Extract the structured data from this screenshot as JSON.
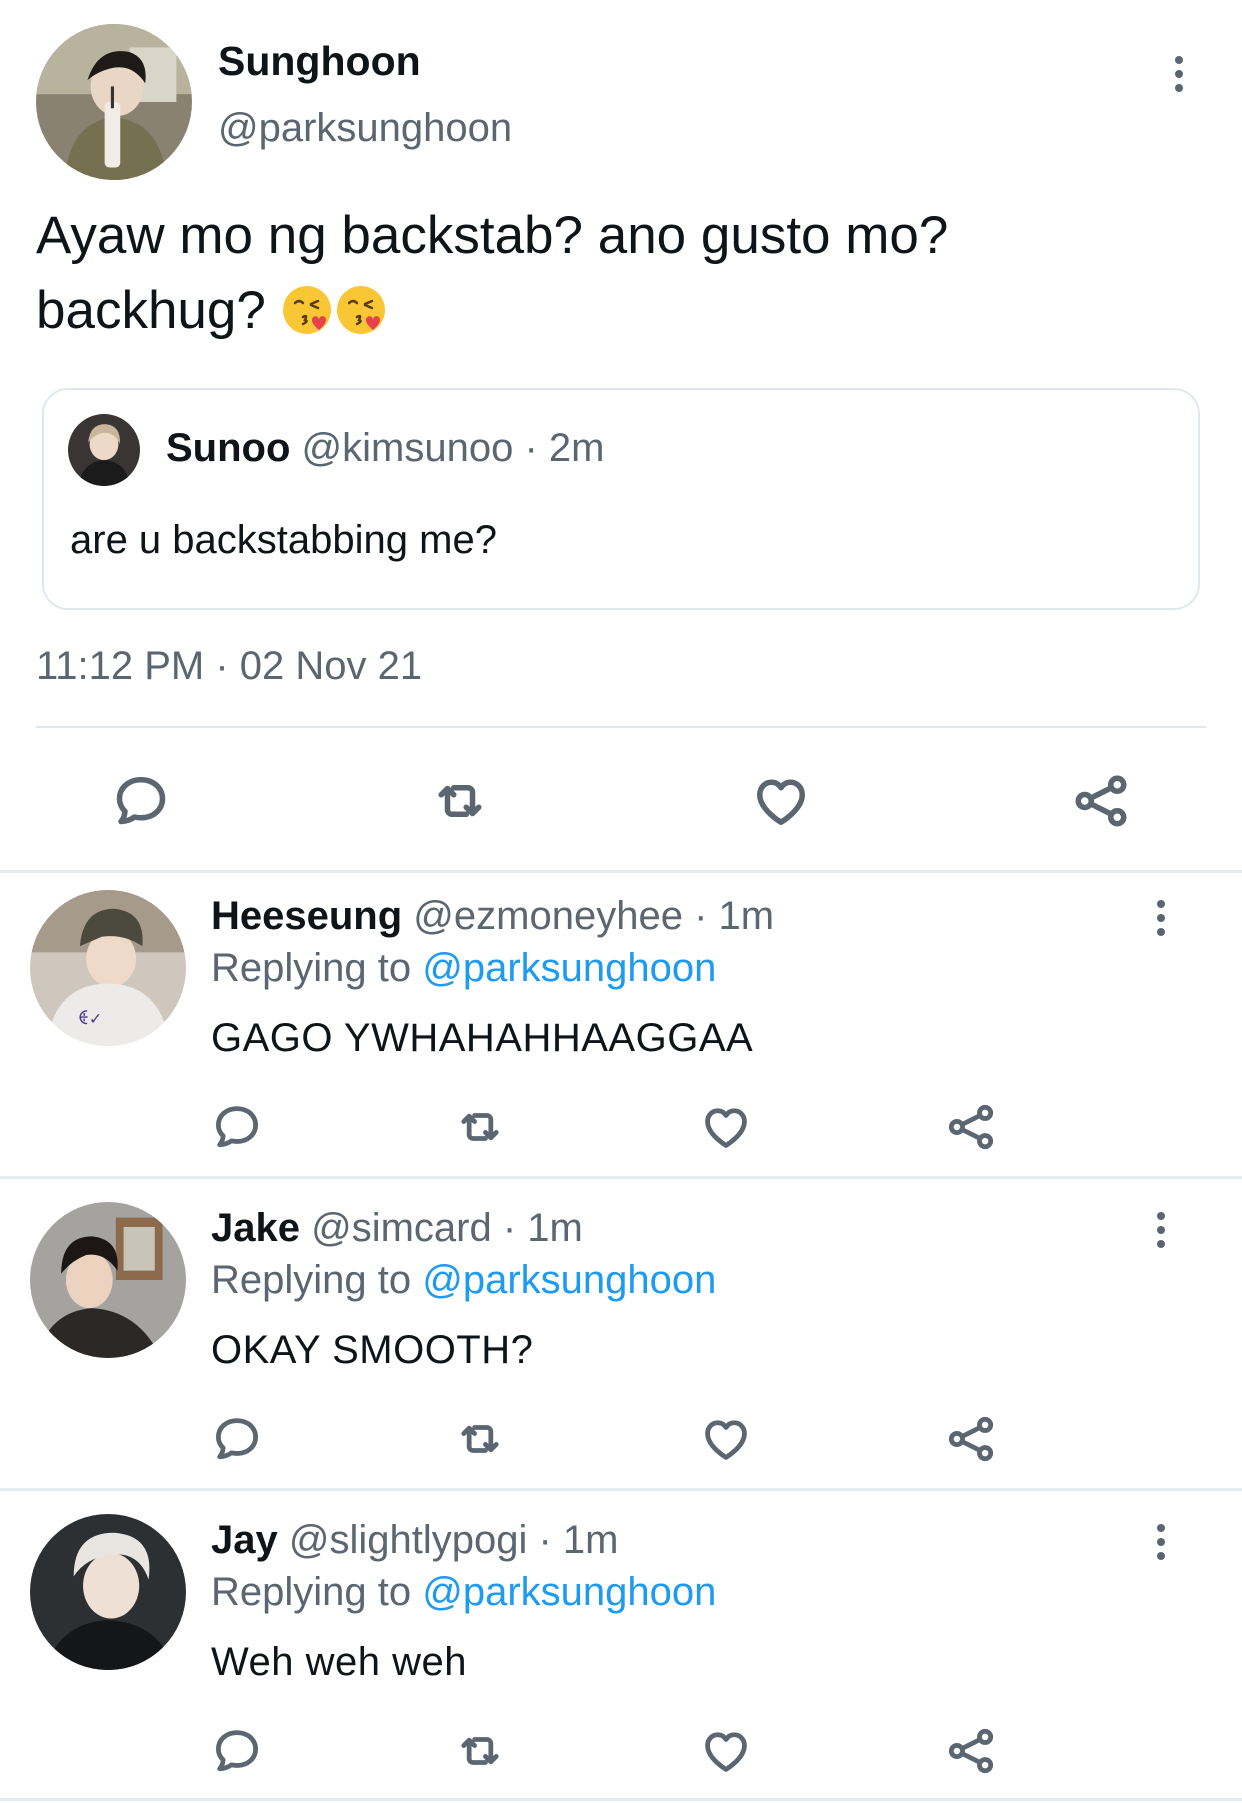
{
  "main_tweet": {
    "name": "Sunghoon",
    "handle": "@parksunghoon",
    "text": "Ayaw mo ng backstab? ano gusto mo? backhug?",
    "emoji_names": [
      "kissing-heart-emoji",
      "kissing-heart-emoji"
    ],
    "quoted": {
      "name": "Sunoo",
      "handle": "@kimsunoo",
      "time": "· 2m",
      "text": "are u backstabbing me?"
    },
    "timestamp": "11:12 PM · 02 Nov 21"
  },
  "replies": [
    {
      "name": "Heeseung",
      "handle": "@ezmoneyhee",
      "time": "· 1m",
      "replying_label": "Replying to",
      "replying_to": "@parksunghoon",
      "text": "GAGO YWHAHAHHAAGGAA"
    },
    {
      "name": "Jake",
      "handle": "@simcard",
      "time": "· 1m",
      "replying_label": "Replying to",
      "replying_to": "@parksunghoon",
      "text": "OKAY SMOOTH?"
    },
    {
      "name": "Jay",
      "handle": "@slightlypogi",
      "time": "· 1m",
      "replying_label": "Replying to",
      "replying_to": "@parksunghoon",
      "text": "Weh weh weh"
    }
  ],
  "icons": {
    "actions": [
      "reply-icon",
      "retweet-icon",
      "like-icon",
      "share-icon"
    ],
    "menu": "more-icon"
  },
  "colors": {
    "text": "#0f1419",
    "muted": "#5b6670",
    "link": "#1d9bf0",
    "divider": "#e6ecf0"
  }
}
